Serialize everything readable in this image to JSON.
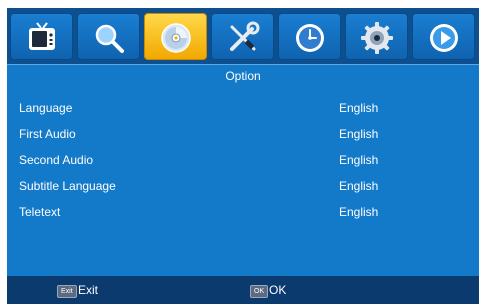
{
  "menu": {
    "title": "Option",
    "tabs": [
      {
        "icon": "tv-icon"
      },
      {
        "icon": "search-icon"
      },
      {
        "icon": "disc-icon",
        "active": true
      },
      {
        "icon": "tools-icon"
      },
      {
        "icon": "clock-icon"
      },
      {
        "icon": "settings-gear-icon"
      },
      {
        "icon": "play-icon"
      }
    ],
    "items": [
      {
        "label": "Language",
        "value": "English"
      },
      {
        "label": "First Audio",
        "value": "English"
      },
      {
        "label": "Second Audio",
        "value": "English"
      },
      {
        "label": "Subtitle Language",
        "value": "English"
      },
      {
        "label": "Teletext",
        "value": "English"
      }
    ]
  },
  "footer": {
    "exit_key": "Exit",
    "exit_label": "Exit",
    "ok_key": "OK",
    "ok_label": "OK"
  },
  "colors": {
    "background": "#1379c9",
    "active_tab": "#f2a800",
    "footer": "#0b3a6e"
  }
}
